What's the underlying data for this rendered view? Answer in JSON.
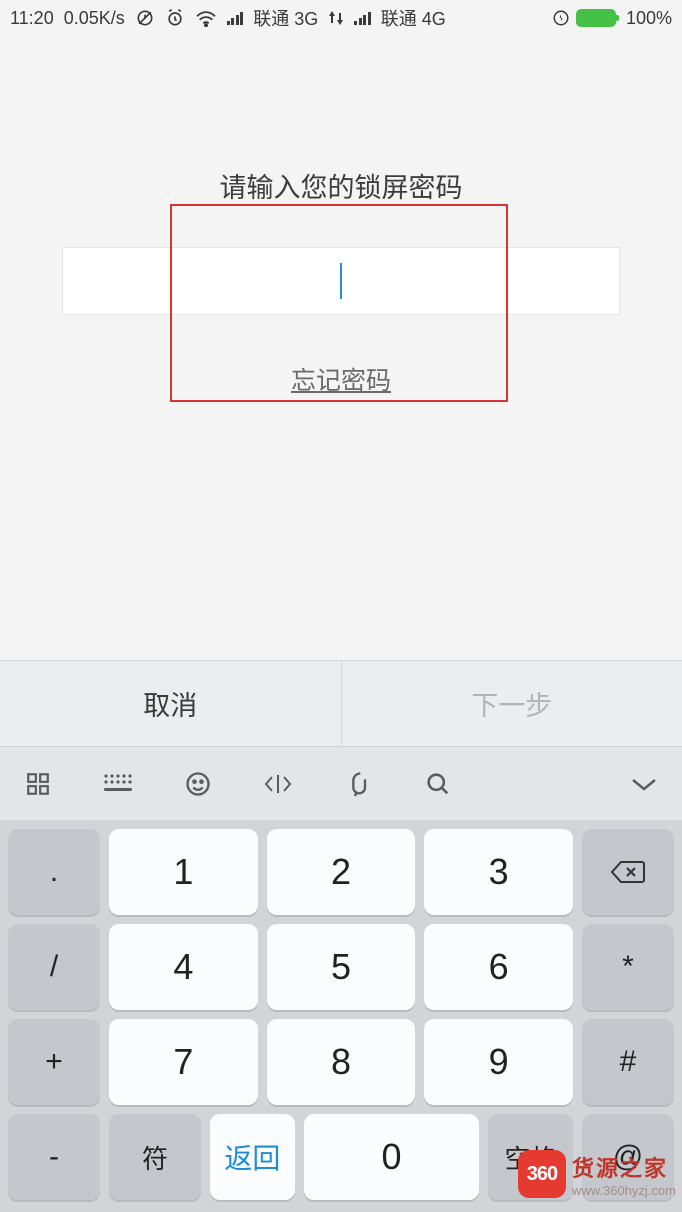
{
  "status": {
    "time": "11:20",
    "speed": "0.05K/s",
    "carrier1": "联通 3G",
    "carrier2": "联通 4G",
    "battery_pct": "100%"
  },
  "lock": {
    "prompt": "请输入您的锁屏密码",
    "forgot": "忘记密码"
  },
  "actions": {
    "cancel": "取消",
    "next": "下一步"
  },
  "keypad": {
    "dot": ".",
    "slash": "/",
    "plus": "+",
    "minus": "-",
    "star": "*",
    "hash": "#",
    "at": "@",
    "n1": "1",
    "n2": "2",
    "n3": "3",
    "n4": "4",
    "n5": "5",
    "n6": "6",
    "n7": "7",
    "n8": "8",
    "n9": "9",
    "n0": "0",
    "fu": "符",
    "return": "返回",
    "space": "空格"
  },
  "watermark": {
    "badge": "360",
    "title": "货源之家",
    "url": "www.360hyzj.com"
  }
}
